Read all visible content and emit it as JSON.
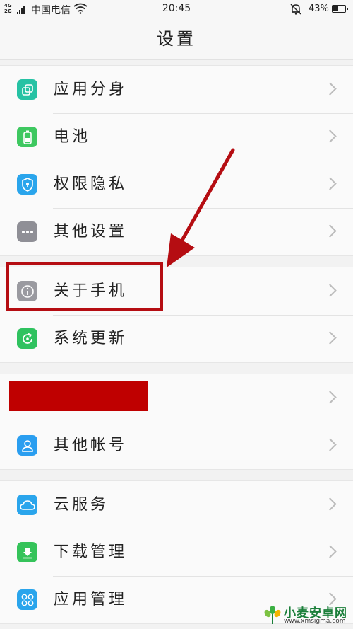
{
  "status": {
    "network": [
      "4G",
      "2G"
    ],
    "carrier": "中国电信",
    "time": "20:45",
    "battery": "43%",
    "icons": {
      "signal": "signal-icon",
      "wifi": "wifi-icon",
      "mute": "bell-mute-icon",
      "battery": "battery-icon"
    }
  },
  "header": {
    "title": "设置"
  },
  "groups": [
    {
      "items": [
        {
          "label": "应用分身",
          "icon": "app-clone-icon",
          "color": "#26c2a4"
        },
        {
          "label": "电池",
          "icon": "battery-icon",
          "color": "#3ec860"
        },
        {
          "label": "权限隐私",
          "icon": "shield-icon",
          "color": "#2aa5ec"
        },
        {
          "label": "其他设置",
          "icon": "more-icon",
          "color": "#8f8f96"
        }
      ]
    },
    {
      "items": [
        {
          "label": "关于手机",
          "icon": "info-icon",
          "color": "#9a9aa0"
        },
        {
          "label": "系统更新",
          "icon": "update-icon",
          "color": "#2fc25f"
        }
      ]
    },
    {
      "items": [
        {
          "label": "",
          "icon": "",
          "color": "#bf0000"
        },
        {
          "label": "其他帐号",
          "icon": "user-icon",
          "color": "#2a9ef0"
        }
      ]
    },
    {
      "items": [
        {
          "label": "云服务",
          "icon": "cloud-icon",
          "color": "#2aa5ec"
        },
        {
          "label": "下载管理",
          "icon": "download-icon",
          "color": "#35c35a"
        },
        {
          "label": "应用管理",
          "icon": "apps-icon",
          "color": "#2aa5ec"
        }
      ]
    }
  ],
  "annotation": {
    "color": "#b50d12"
  },
  "watermark": {
    "title": "小麦安卓网",
    "url": "www.xmsigma.com"
  }
}
